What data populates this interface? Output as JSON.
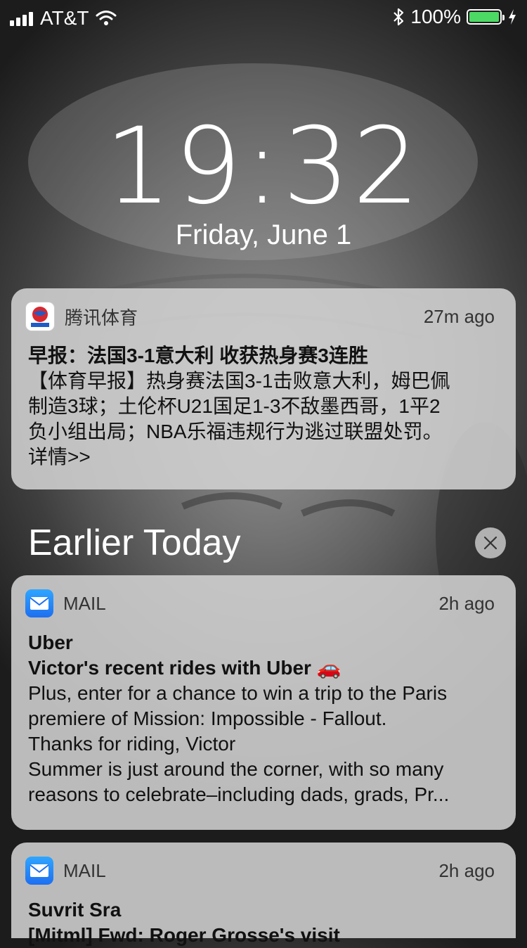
{
  "status_bar": {
    "carrier": "AT&T",
    "battery": "100%",
    "battery_level": 1.0
  },
  "lock_screen": {
    "time": "19:32",
    "date": "Friday, June 1"
  },
  "notifications": [
    {
      "app": "腾讯体育",
      "time": "27m ago",
      "title": "早报：法国3-1意大利 收获热身赛3连胜",
      "lines": [
        "【体育早报】热身赛法国3-1击败意大利，姆巴佩",
        "制造3球；土伦杯U21国足1-3不敌墨西哥，1平2",
        "负小组出局；NBA乐福违规行为逃过联盟处罚。",
        "详情>>"
      ]
    }
  ],
  "earlier": {
    "title": "Earlier Today",
    "notifications": [
      {
        "app": "MAIL",
        "time": "2h ago",
        "sender": "Uber",
        "subject": "Victor's recent rides with Uber 🚗",
        "lines": [
          "Plus, enter for a chance to win a trip to the Paris",
          "premiere of Mission: Impossible - Fallout.",
          "Thanks for riding, Victor",
          "Summer is just around the corner, with so many",
          "reasons to celebrate–including dads, grads, Pr..."
        ]
      },
      {
        "app": "MAIL",
        "time": "2h ago",
        "sender": "Suvrit Sra",
        "subject": "[Mitml] Fwd: Roger Grosse's visit"
      }
    ]
  },
  "colors": {
    "battery_fill": "#4cd964",
    "mail_icon": "#1e8ef5",
    "card_bg": "#d2d2d2"
  }
}
